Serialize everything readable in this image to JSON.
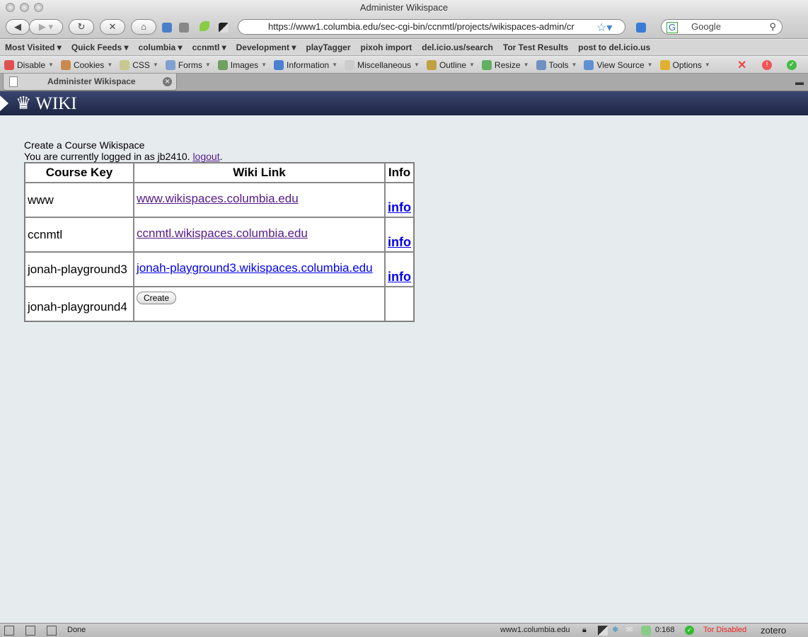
{
  "window": {
    "title": "Administer Wikispace"
  },
  "nav": {
    "url": "https://www1.columbia.edu/sec-cgi-bin/ccnmtl/projects/wikispaces-admin/cr",
    "search_placeholder": "Google"
  },
  "bookmarks": [
    "Most Visited ▾",
    "Quick Feeds ▾",
    "columbia ▾",
    "ccnmtl ▾",
    "Development ▾",
    "playTagger",
    "pixoh import",
    "del.icio.us/search",
    "Tor Test Results",
    "post to del.icio.us"
  ],
  "devbar": [
    {
      "label": "Disable",
      "icon": "disable-icon",
      "color": "#e05050"
    },
    {
      "label": "Cookies",
      "icon": "cookies-icon",
      "color": "#c98a50"
    },
    {
      "label": "CSS",
      "icon": "css-icon",
      "color": "#c8c890"
    },
    {
      "label": "Forms",
      "icon": "forms-icon",
      "color": "#7fa0d0"
    },
    {
      "label": "Images",
      "icon": "images-icon",
      "color": "#70a060"
    },
    {
      "label": "Information",
      "icon": "information-icon",
      "color": "#4a80d0"
    },
    {
      "label": "Miscellaneous",
      "icon": "miscellaneous-icon",
      "color": "#ccc"
    },
    {
      "label": "Outline",
      "icon": "outline-icon",
      "color": "#c0a040"
    },
    {
      "label": "Resize",
      "icon": "resize-icon",
      "color": "#60b060"
    },
    {
      "label": "Tools",
      "icon": "tools-icon",
      "color": "#7090c0"
    },
    {
      "label": "View Source",
      "icon": "view-source-icon",
      "color": "#6090d0"
    },
    {
      "label": "Options",
      "icon": "options-icon",
      "color": "#e0b030"
    }
  ],
  "tab": {
    "title": "Administer Wikispace"
  },
  "header": {
    "logo": "WIKI"
  },
  "page": {
    "heading": "Create a Course Wikispace",
    "logged_in_prefix": "You are currently logged in as jb2410.",
    "logout": "logout",
    "columns": [
      "Course Key",
      "Wiki Link",
      "Info"
    ],
    "rows": [
      {
        "key": "www",
        "link": "www.wikispaces.columbia.edu",
        "info": "info",
        "visited": true
      },
      {
        "key": "ccnmtl",
        "link": "ccnmtl.wikispaces.columbia.edu",
        "info": "info",
        "visited": true
      },
      {
        "key": "jonah-playground3",
        "link": "jonah-playground3.wikispaces.columbia.edu",
        "info": "info",
        "visited": false
      }
    ],
    "new_row": {
      "key": "jonah-playground4",
      "button": "Create"
    }
  },
  "status": {
    "text": "Done",
    "host": "www1.columbia.edu",
    "counter": "0:168",
    "tor": "Tor Disabled",
    "zotero": "zotero"
  }
}
